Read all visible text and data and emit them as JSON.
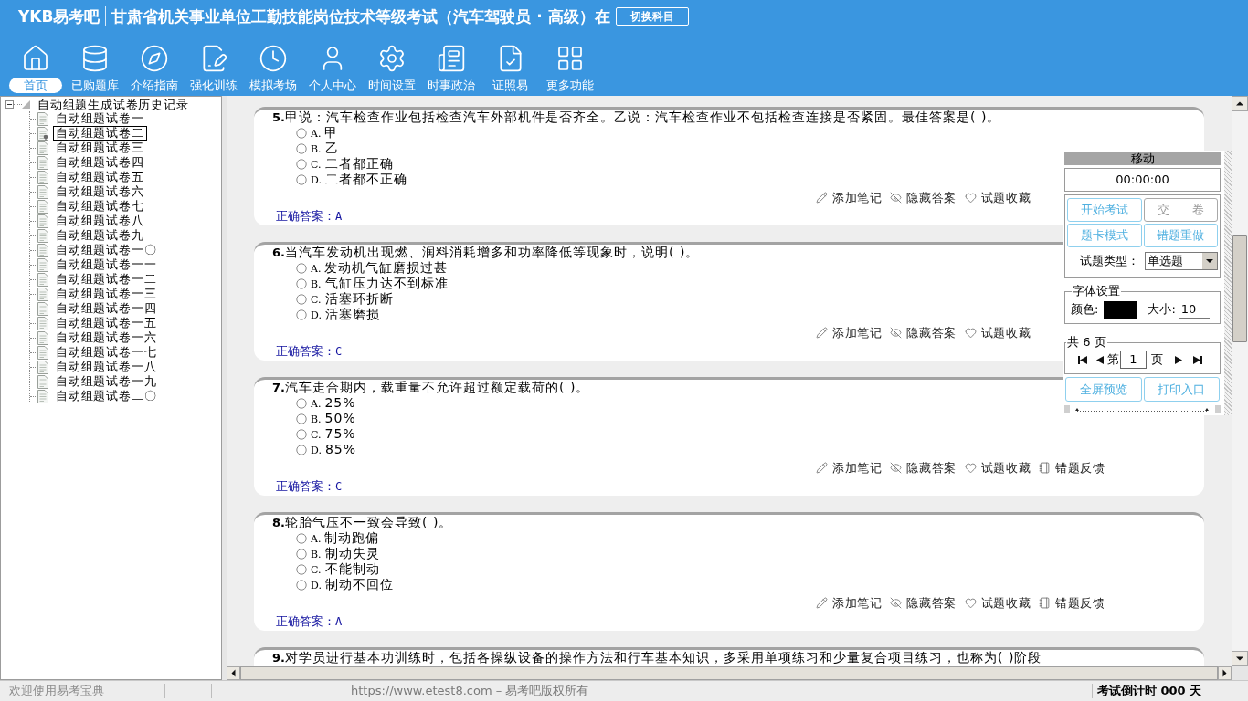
{
  "header": {
    "logo": "YKB易考吧",
    "title": "甘肃省机关事业单位工勤技能岗位技术等级考试（汽车驾驶员 · 高级）在",
    "switch_button": "切换科目"
  },
  "nav": [
    {
      "kind": "home",
      "label": "首页",
      "selected": true
    },
    {
      "kind": "database",
      "label": "已购题库",
      "selected": false
    },
    {
      "kind": "compass",
      "label": "介绍指南",
      "selected": false
    },
    {
      "kind": "edit",
      "label": "强化训练",
      "selected": false
    },
    {
      "kind": "clock",
      "label": "模拟考场",
      "selected": false
    },
    {
      "kind": "user",
      "label": "个人中心",
      "selected": false
    },
    {
      "kind": "settings",
      "label": "时间设置",
      "selected": false
    },
    {
      "kind": "newspaper",
      "label": "时事政治",
      "selected": false
    },
    {
      "kind": "checklist",
      "label": "证照易",
      "selected": false
    },
    {
      "kind": "grid",
      "label": "更多功能",
      "selected": false
    }
  ],
  "tree": {
    "label": "自动组题生成试卷历史记录",
    "expanded": true,
    "children": [
      {
        "label": "自动组题试卷一",
        "selected": false
      },
      {
        "label": "自动组题试卷二",
        "selected": true
      },
      {
        "label": "自动组题试卷三",
        "selected": false
      },
      {
        "label": "自动组题试卷四",
        "selected": false
      },
      {
        "label": "自动组题试卷五",
        "selected": false
      },
      {
        "label": "自动组题试卷六",
        "selected": false
      },
      {
        "label": "自动组题试卷七",
        "selected": false
      },
      {
        "label": "自动组题试卷八",
        "selected": false
      },
      {
        "label": "自动组题试卷九",
        "selected": false
      },
      {
        "label": "自动组题试卷一〇",
        "selected": false
      },
      {
        "label": "自动组题试卷一一",
        "selected": false
      },
      {
        "label": "自动组题试卷一二",
        "selected": false
      },
      {
        "label": "自动组题试卷一三",
        "selected": false
      },
      {
        "label": "自动组题试卷一四",
        "selected": false
      },
      {
        "label": "自动组题试卷一五",
        "selected": false
      },
      {
        "label": "自动组题试卷一六",
        "selected": false
      },
      {
        "label": "自动组题试卷一七",
        "selected": false
      },
      {
        "label": "自动组题试卷一八",
        "selected": false
      },
      {
        "label": "自动组题试卷一九",
        "selected": false
      },
      {
        "label": "自动组题试卷二〇",
        "selected": false
      }
    ]
  },
  "questions": [
    {
      "number": "5.",
      "text": "甲说：汽车检查作业包括检查汽车外部机件是否齐全。乙说：汽车检查作业不包括检查连接是否紧固。最佳答案是( )。",
      "options": [
        {
          "label": "A.",
          "text": "甲",
          "selected": false
        },
        {
          "label": "B.",
          "text": "乙",
          "selected": false
        },
        {
          "label": "C.",
          "text": "二者都正确",
          "selected": false
        },
        {
          "label": "D.",
          "text": "二者都不正确",
          "selected": false
        }
      ],
      "actions": [
        {
          "kind": "note",
          "label": "添加笔记"
        },
        {
          "kind": "hide",
          "label": "隐藏答案"
        },
        {
          "kind": "favorite",
          "label": "试题收藏"
        }
      ],
      "answer_label": "正确答案：",
      "answer": "A"
    },
    {
      "number": "6.",
      "text": "当汽车发动机出现燃、润料消耗增多和功率降低等现象时，说明( )。",
      "options": [
        {
          "label": "A.",
          "text": "发动机气缸磨损过甚",
          "selected": false
        },
        {
          "label": "B.",
          "text": "气缸压力达不到标准",
          "selected": false
        },
        {
          "label": "C.",
          "text": "活塞环折断",
          "selected": false
        },
        {
          "label": "D.",
          "text": "活塞磨损",
          "selected": false
        }
      ],
      "actions": [
        {
          "kind": "note",
          "label": "添加笔记"
        },
        {
          "kind": "hide",
          "label": "隐藏答案"
        },
        {
          "kind": "favorite",
          "label": "试题收藏"
        }
      ],
      "answer_label": "正确答案：",
      "answer": "C"
    },
    {
      "number": "7.",
      "text": "汽车走合期内，载重量不允许超过额定载荷的( )。",
      "options": [
        {
          "label": "A.",
          "text": "25%",
          "selected": false
        },
        {
          "label": "B.",
          "text": "50%",
          "selected": false
        },
        {
          "label": "C.",
          "text": "75%",
          "selected": false
        },
        {
          "label": "D.",
          "text": "85%",
          "selected": false
        }
      ],
      "actions": [
        {
          "kind": "note",
          "label": "添加笔记"
        },
        {
          "kind": "hide",
          "label": "隐藏答案"
        },
        {
          "kind": "favorite",
          "label": "试题收藏"
        },
        {
          "kind": "feedback",
          "label": "错题反馈"
        }
      ],
      "answer_label": "正确答案：",
      "answer": "C"
    },
    {
      "number": "8.",
      "text": "轮胎气压不一致会导致( )。",
      "options": [
        {
          "label": "A.",
          "text": "制动跑偏",
          "selected": false
        },
        {
          "label": "B.",
          "text": "制动失灵",
          "selected": false
        },
        {
          "label": "C.",
          "text": "不能制动",
          "selected": false
        },
        {
          "label": "D.",
          "text": "制动不回位",
          "selected": false
        }
      ],
      "actions": [
        {
          "kind": "note",
          "label": "添加笔记"
        },
        {
          "kind": "hide",
          "label": "隐藏答案"
        },
        {
          "kind": "favorite",
          "label": "试题收藏"
        },
        {
          "kind": "feedback",
          "label": "错题反馈"
        }
      ],
      "answer_label": "正确答案：",
      "answer": "A"
    },
    {
      "number": "9.",
      "text": "对学员进行基本功训练时，包括各操纵设备的操作方法和行车基本知识，多采用单项练习和少量复合项目练习，也称为( )阶段"
    }
  ],
  "panel": {
    "title": "移动",
    "timer": "00:00:00",
    "buttons": [
      {
        "label": "开始考试",
        "disabled": false
      },
      {
        "label": "交 卷",
        "disabled": true
      },
      {
        "label": "题卡模式",
        "disabled": false
      },
      {
        "label": "错题重做",
        "disabled": false
      }
    ],
    "type_label": "试题类型：",
    "type_value": "单选题",
    "font_group": {
      "title": "字体设置",
      "color_label": "颜色:",
      "color": "#000000",
      "size_label": "大小:",
      "size_value": "10"
    },
    "pager": {
      "title": "共 6 页",
      "prefix": "第",
      "page": "1",
      "suffix": "页"
    },
    "bottom_buttons": [
      {
        "label": "全屏预览",
        "disabled": false
      },
      {
        "label": "打印入口",
        "disabled": false
      }
    ]
  },
  "status_bar": {
    "welcome": "欢迎使用易考宝典",
    "copyright": "https://www.etest8.com – 易考吧版权所有",
    "countdown": "考试倒计时 000 天"
  }
}
